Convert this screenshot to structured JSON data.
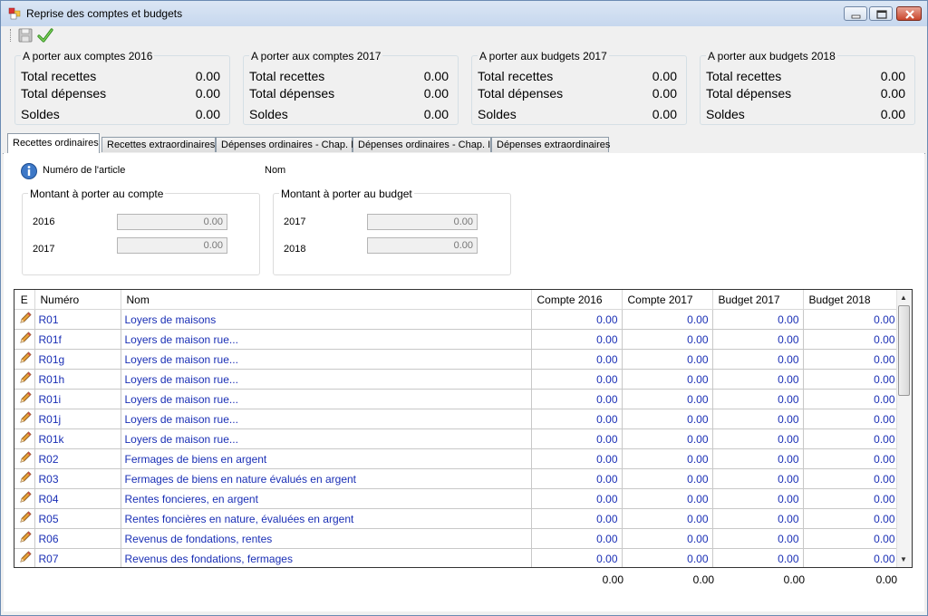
{
  "window": {
    "title": "Reprise des comptes et budgets"
  },
  "summary": [
    {
      "title": "A porter aux comptes 2016",
      "rows": [
        {
          "label": "Total recettes",
          "value": "0.00"
        },
        {
          "label": "Total dépenses",
          "value": "0.00"
        },
        {
          "label": "Soldes",
          "value": "0.00"
        }
      ]
    },
    {
      "title": "A porter aux comptes 2017",
      "rows": [
        {
          "label": "Total recettes",
          "value": "0.00"
        },
        {
          "label": "Total dépenses",
          "value": "0.00"
        },
        {
          "label": "Soldes",
          "value": "0.00"
        }
      ]
    },
    {
      "title": "A porter aux budgets 2017",
      "rows": [
        {
          "label": "Total recettes",
          "value": "0.00"
        },
        {
          "label": "Total dépenses",
          "value": "0.00"
        },
        {
          "label": "Soldes",
          "value": "0.00"
        }
      ]
    },
    {
      "title": "A porter aux budgets 2018",
      "rows": [
        {
          "label": "Total recettes",
          "value": "0.00"
        },
        {
          "label": "Total dépenses",
          "value": "0.00"
        },
        {
          "label": "Soldes",
          "value": "0.00"
        }
      ]
    }
  ],
  "tabs": [
    {
      "label": "Recettes ordinaires",
      "active": true
    },
    {
      "label": "Recettes extraordinaires"
    },
    {
      "label": "Dépenses ordinaires - Chap. I"
    },
    {
      "label": "Dépenses ordinaires - Chap. II"
    },
    {
      "label": "Dépenses extraordinaires"
    }
  ],
  "article": {
    "numero_label": "Numéro de l'article",
    "nom_label": "Nom",
    "compte_group": "Montant à porter au compte",
    "budget_group": "Montant à porter au budget",
    "compte_rows": [
      {
        "year": "2016",
        "value": "0.00"
      },
      {
        "year": "2017",
        "value": "0.00"
      }
    ],
    "budget_rows": [
      {
        "year": "2017",
        "value": "0.00"
      },
      {
        "year": "2018",
        "value": "0.00"
      }
    ]
  },
  "grid": {
    "columns": [
      "E",
      "Numéro",
      "Nom",
      "Compte 2016",
      "Compte 2017",
      "Budget 2017",
      "Budget 2018"
    ],
    "rows": [
      {
        "numero": "R01",
        "nom": "Loyers de maisons",
        "c2016": "0.00",
        "c2017": "0.00",
        "b2017": "0.00",
        "b2018": "0.00"
      },
      {
        "numero": "R01f",
        "nom": "Loyers de maison rue...",
        "c2016": "0.00",
        "c2017": "0.00",
        "b2017": "0.00",
        "b2018": "0.00"
      },
      {
        "numero": "R01g",
        "nom": "Loyers de maison rue...",
        "c2016": "0.00",
        "c2017": "0.00",
        "b2017": "0.00",
        "b2018": "0.00"
      },
      {
        "numero": "R01h",
        "nom": "Loyers de maison rue...",
        "c2016": "0.00",
        "c2017": "0.00",
        "b2017": "0.00",
        "b2018": "0.00"
      },
      {
        "numero": "R01i",
        "nom": "Loyers de maison rue...",
        "c2016": "0.00",
        "c2017": "0.00",
        "b2017": "0.00",
        "b2018": "0.00"
      },
      {
        "numero": "R01j",
        "nom": "Loyers de maison rue...",
        "c2016": "0.00",
        "c2017": "0.00",
        "b2017": "0.00",
        "b2018": "0.00"
      },
      {
        "numero": "R01k",
        "nom": "Loyers de maison rue...",
        "c2016": "0.00",
        "c2017": "0.00",
        "b2017": "0.00",
        "b2018": "0.00"
      },
      {
        "numero": "R02",
        "nom": "Fermages de biens en argent",
        "c2016": "0.00",
        "c2017": "0.00",
        "b2017": "0.00",
        "b2018": "0.00"
      },
      {
        "numero": "R03",
        "nom": "Fermages de biens en nature évalués en argent",
        "c2016": "0.00",
        "c2017": "0.00",
        "b2017": "0.00",
        "b2018": "0.00"
      },
      {
        "numero": "R04",
        "nom": "Rentes foncieres, en argent",
        "c2016": "0.00",
        "c2017": "0.00",
        "b2017": "0.00",
        "b2018": "0.00"
      },
      {
        "numero": "R05",
        "nom": "Rentes foncières en nature, évaluées en argent",
        "c2016": "0.00",
        "c2017": "0.00",
        "b2017": "0.00",
        "b2018": "0.00"
      },
      {
        "numero": "R06",
        "nom": "Revenus de fondations, rentes",
        "c2016": "0.00",
        "c2017": "0.00",
        "b2017": "0.00",
        "b2018": "0.00"
      },
      {
        "numero": "R07",
        "nom": "Revenus des fondations, fermages",
        "c2016": "0.00",
        "c2017": "0.00",
        "b2017": "0.00",
        "b2018": "0.00"
      }
    ],
    "totals": [
      "0.00",
      "0.00",
      "0.00",
      "0.00"
    ]
  }
}
